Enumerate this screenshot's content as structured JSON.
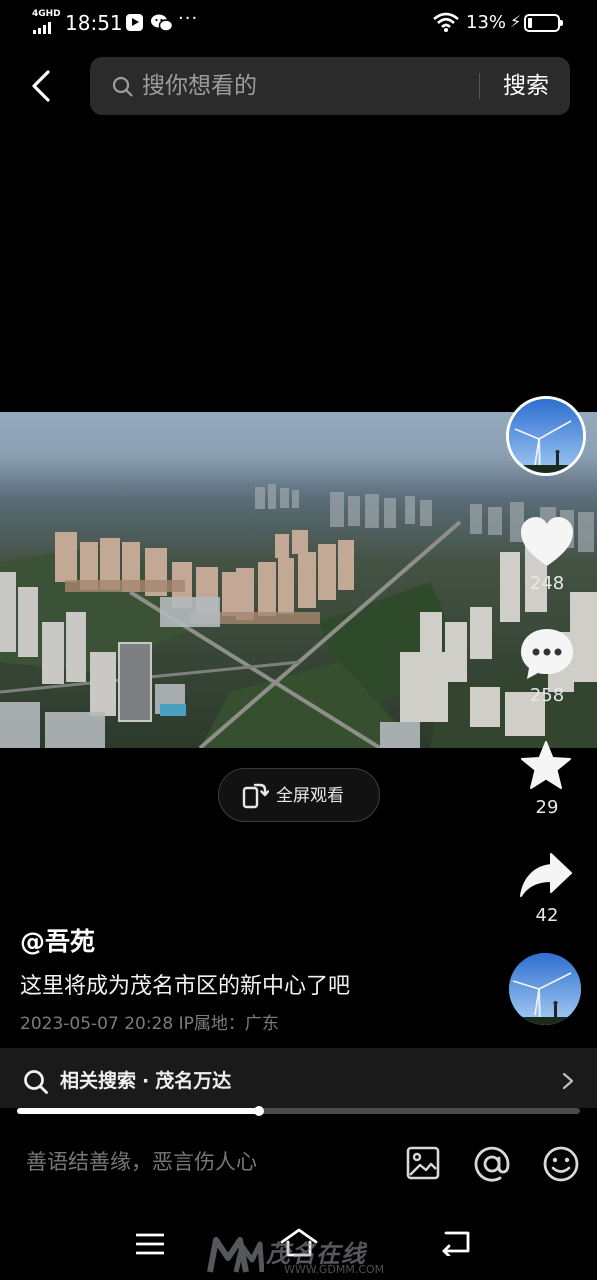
{
  "status_bar": {
    "network": "4GHD",
    "time": "18:51",
    "more": "···",
    "battery": "13%"
  },
  "header": {
    "search_placeholder": "搜你想看的",
    "search_button": "搜索"
  },
  "video": {
    "fullscreen_label": "全屏观看",
    "progress": 0.43
  },
  "actions": {
    "likes": "248",
    "comments": "258",
    "favorites": "29",
    "shares": "42"
  },
  "post": {
    "author": "@吾苑",
    "caption": "这里将成为茂名市区的新中心了吧",
    "meta": "2023-05-07 20:28  IP属地：广东"
  },
  "related": {
    "label": "相关搜索",
    "separator": "·",
    "keyword": "茂名万达"
  },
  "comment_bar": {
    "placeholder": "善语结善缘，恶言伤人心"
  },
  "watermark": {
    "text": "茂名在线",
    "url": "WWW.GDMM.COM"
  },
  "colors": {
    "background": "#000000",
    "search_box": "#2b2b2b",
    "related_bar": "#1a1a1a",
    "muted_text": "#7c7c7c"
  }
}
